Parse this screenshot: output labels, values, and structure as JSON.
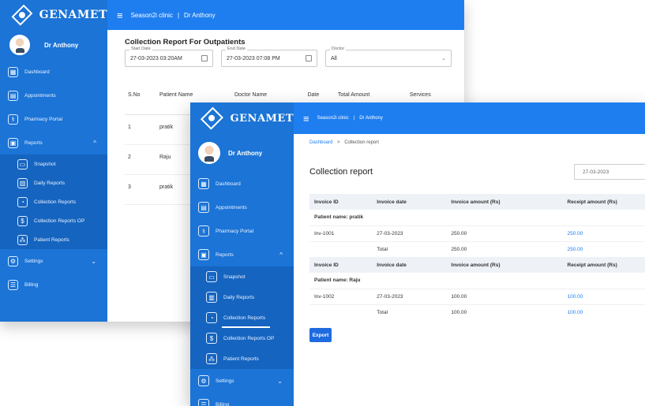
{
  "brand": {
    "name": "GENAMET"
  },
  "topbar": {
    "clinic": "Season2i clinic",
    "separator": "|",
    "doctor": "Dr Anthony",
    "menu_glyph": "≡"
  },
  "user": {
    "name": "Dr Anthony"
  },
  "sidebar": {
    "items": {
      "dashboard": "Dashboard",
      "appointments": "Appointments",
      "pharmacy": "Pharmacy Portal",
      "reports": "Reports",
      "settings": "Settings",
      "billing": "Billing"
    },
    "sub_items": {
      "snapshot": "Snapshot",
      "daily": "Daily Reports",
      "collection": "Collection Reports",
      "collection_op": "Collection Reports OP",
      "patient": "Patient Reports"
    }
  },
  "back_report": {
    "title": "Collection Report For Outpatients",
    "filters": {
      "start_label": "Start Date",
      "start_value": "27-03-2023 03:20AM",
      "end_label": "End Date",
      "end_value": "27-03-2023 07:08 PM",
      "doctor_label": "Doctor",
      "doctor_value": "All"
    },
    "columns": [
      "S.No",
      "Patient Name",
      "Doctor Name",
      "Date",
      "Total Amount",
      "Services"
    ],
    "rows": [
      {
        "sno": "1",
        "name": "pratik"
      },
      {
        "sno": "2",
        "name": "Raju"
      },
      {
        "sno": "3",
        "name": "pratik"
      }
    ]
  },
  "front_report": {
    "breadcrumb": {
      "home": "Dashboard",
      "sep": ">",
      "current": "Collection report"
    },
    "title": "Collection report",
    "date_value": "27-03-2023",
    "columns": [
      "Invoice ID",
      "Invoice date",
      "Invoice amount (Rs)",
      "Receipt amount (Rs)"
    ],
    "groups": [
      {
        "patient_label": "Patient name: pratik",
        "invoice": {
          "id": "Inv-1001",
          "date": "27-03-2023",
          "amount": "250.00",
          "receipt": "250.00"
        },
        "total": {
          "label": "Total",
          "amount": "250.00",
          "receipt": "250.00"
        }
      },
      {
        "patient_label": "Patient name: Raju",
        "invoice": {
          "id": "Inv-1002",
          "date": "27-03-2023",
          "amount": "100.00",
          "receipt": "100.00"
        },
        "total": {
          "label": "Total",
          "amount": "100.00",
          "receipt": "100.00"
        }
      }
    ],
    "export_label": "Export"
  }
}
